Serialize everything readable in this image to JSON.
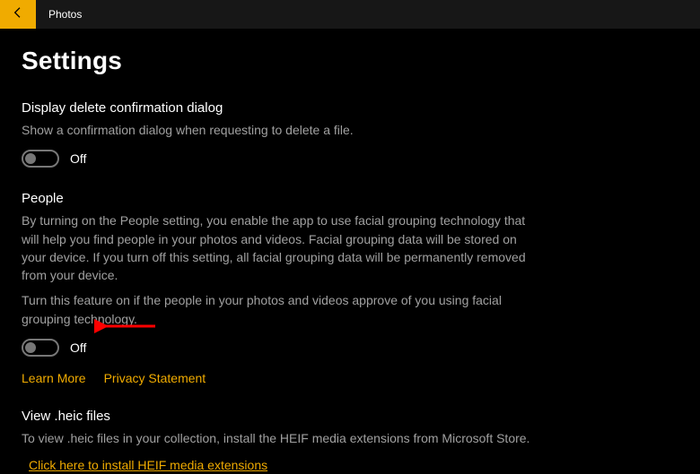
{
  "app": {
    "title": "Photos"
  },
  "page": {
    "title": "Settings"
  },
  "sections": {
    "deleteConfirm": {
      "heading": "Display delete confirmation dialog",
      "desc": "Show a confirmation dialog when requesting to delete a file.",
      "toggle": "Off"
    },
    "people": {
      "heading": "People",
      "desc1": "By turning on the People setting, you enable the app to use facial grouping technology that will help you find people in your photos and videos. Facial grouping data will be stored on your device. If you turn off this setting, all facial grouping data will be permanently removed from your device.",
      "desc2": "Turn this feature on if the people in your photos and videos approve of you using facial grouping technology.",
      "toggle": "Off",
      "learnMore": "Learn More",
      "privacy": "Privacy Statement"
    },
    "heic": {
      "heading": "View .heic files",
      "desc": "To view .heic files in your collection, install the HEIF media extensions from Microsoft Store.",
      "link": "Click here to install HEIF media extensions"
    }
  }
}
